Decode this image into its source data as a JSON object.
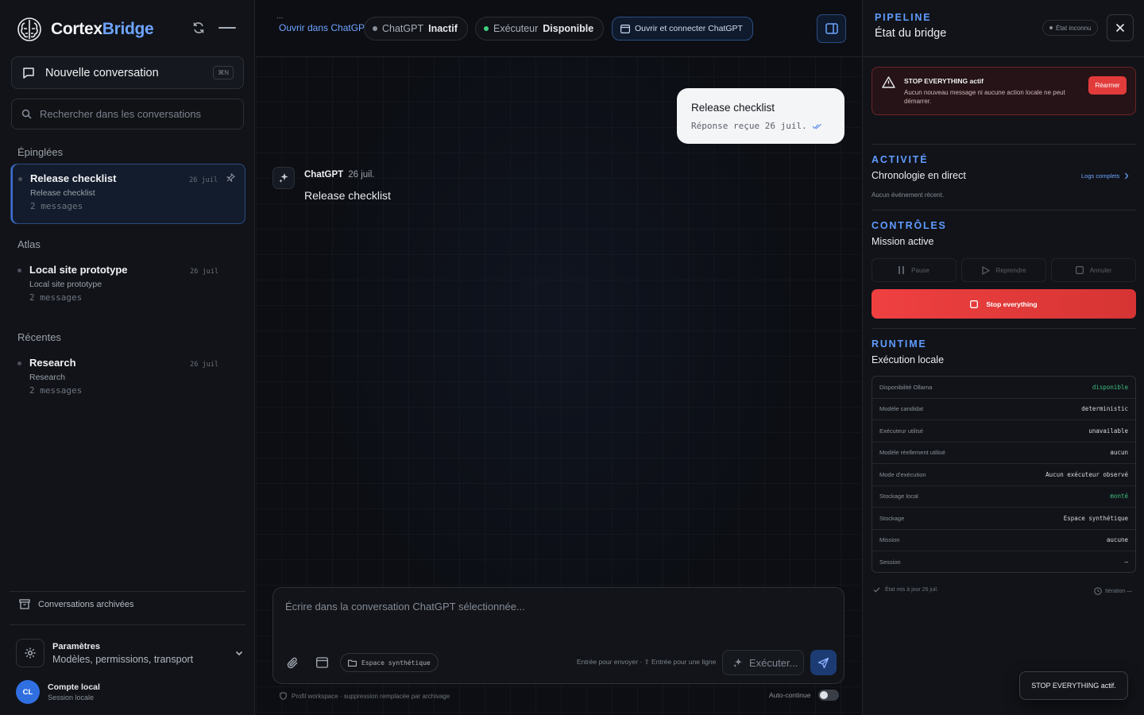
{
  "app": {
    "brand_primary": "Cortex",
    "brand_accent": "Bridge",
    "accent_color": "#6ea4ff",
    "danger_color": "#e23b3b"
  },
  "sidebar": {
    "new_conversation": "Nouvelle conversation",
    "new_conversation_kbd": "⌘N",
    "search_placeholder": "Rechercher dans les conversations",
    "sections": [
      {
        "label": "Épinglées",
        "items": [
          {
            "title": "Release checklist",
            "subtitle": "Release checklist",
            "count": "2 messages",
            "date": "26 juil",
            "active": true,
            "pinned": true
          }
        ]
      },
      {
        "label": "Atlas",
        "items": [
          {
            "title": "Local site prototype",
            "subtitle": "Local site prototype",
            "count": "2 messages",
            "date": "26 juil"
          }
        ]
      },
      {
        "label": "Récentes",
        "items": [
          {
            "title": "Research",
            "subtitle": "Research",
            "count": "2 messages",
            "date": "26 juil"
          }
        ]
      }
    ],
    "archived": "Conversations archivées",
    "settings": {
      "title": "Paramètres",
      "subtitle": "Modèles, permissions, transport"
    },
    "account": {
      "initials": "CL",
      "name": "Compte local",
      "session": "Session locale"
    }
  },
  "topbar": {
    "ellipsis": "...",
    "open_link": "Ouvrir dans ChatGPT",
    "chatgpt_label": "ChatGPT",
    "chatgpt_status": "Inactif",
    "executor_label": "Exécuteur",
    "executor_status": "Disponible",
    "connect_button": "Ouvrir et connecter ChatGPT"
  },
  "chat": {
    "user_message": {
      "text": "Release checklist",
      "meta": "Réponse reçue 26 juil."
    },
    "assistant_message": {
      "author": "ChatGPT",
      "date": "26 juil.",
      "text": "Release checklist"
    }
  },
  "composer": {
    "placeholder": "Écrire dans la conversation ChatGPT sélectionnée...",
    "workspace_chip": "Espace synthétique",
    "hint": "Entrée pour envoyer · ⇧ Entrée pour une ligne",
    "execute_label": "Exécuter...",
    "footnote": "Profil workspace · suppression remplacée par archivage",
    "auto_continue": "Auto-continue"
  },
  "panel": {
    "eyebrow": "PIPELINE",
    "title": "État du bridge",
    "badge": "État inconnu",
    "alert": {
      "title": "STOP EVERYTHING actif",
      "body": "Aucun nouveau message ni aucune action locale ne peut démarrer.",
      "button": "Réarmer"
    },
    "activity": {
      "eyebrow": "ACTIVITÉ",
      "title": "Chronologie en direct",
      "logs_link": "Logs complets",
      "empty": "Aucun événement récent."
    },
    "controls": {
      "eyebrow": "CONTRÔLES",
      "title": "Mission active",
      "pause": "Pause",
      "resume": "Reprendre",
      "cancel": "Annuler",
      "stop": "Stop everything"
    },
    "runtime": {
      "eyebrow": "RUNTIME",
      "title": "Exécution locale",
      "rows": [
        {
          "key": "Disponibilité Ollama",
          "value": "disponible",
          "ok": true
        },
        {
          "key": "Modèle candidat",
          "value": "deterministic"
        },
        {
          "key": "Exécuteur utilisé",
          "value": "unavailable"
        },
        {
          "key": "Modèle réellement utilisé",
          "value": "aucun"
        },
        {
          "key": "Mode d'exécution",
          "value": "Aucun exécuteur observé"
        },
        {
          "key": "Stockage local",
          "value": "monté",
          "ok": true
        },
        {
          "key": "Stockage",
          "value": "Espace synthétique"
        },
        {
          "key": "Mission",
          "value": "aucune"
        },
        {
          "key": "Session",
          "value": "—"
        }
      ]
    },
    "footer_left": "État mis à jour 26 juil.",
    "footer_right": "Itération —"
  },
  "toast": "STOP EVERYTHING actif."
}
